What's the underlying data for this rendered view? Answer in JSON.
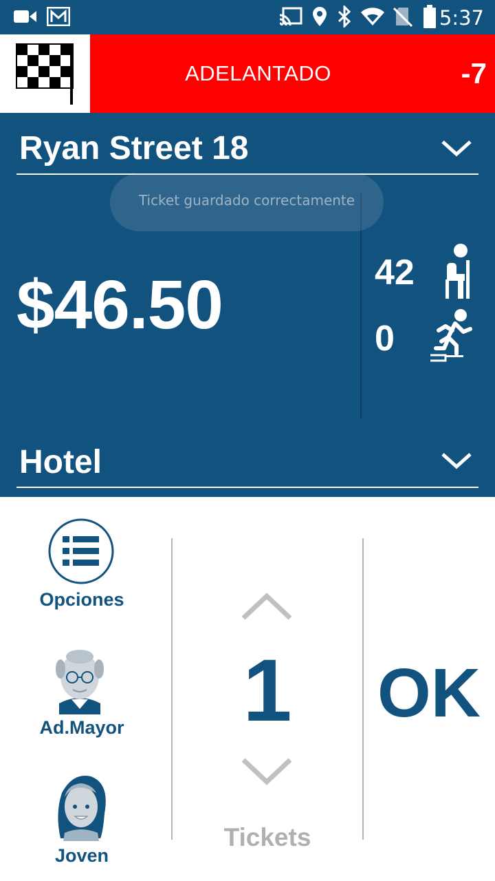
{
  "status_bar": {
    "time": "5:37",
    "icons": [
      "video-camera-icon",
      "gmail-icon",
      "cast-icon",
      "location-icon",
      "bluetooth-icon",
      "wifi-icon",
      "no-sim-icon",
      "battery-icon"
    ]
  },
  "header": {
    "flag_icon": "checkered-flag-icon",
    "status_text": "ADELANTADO",
    "delay": "-7",
    "status_color": "#ff0000"
  },
  "route": {
    "name": "Ryan Street 18"
  },
  "toast": {
    "message": "Ticket guardado correctamente"
  },
  "fare": {
    "amount": "$46.50"
  },
  "occupancy": {
    "seated": "42",
    "standing": "0"
  },
  "destination": {
    "name": "Hotel"
  },
  "side_menu": {
    "options_label": "Opciones",
    "senior_label": "Ad.Mayor",
    "young_label": "Joven"
  },
  "ticket_counter": {
    "quantity": "1",
    "label": "Tickets"
  },
  "confirm": {
    "label": "OK"
  },
  "colors": {
    "brand_blue": "#12527f",
    "alert_red": "#ff0000"
  }
}
